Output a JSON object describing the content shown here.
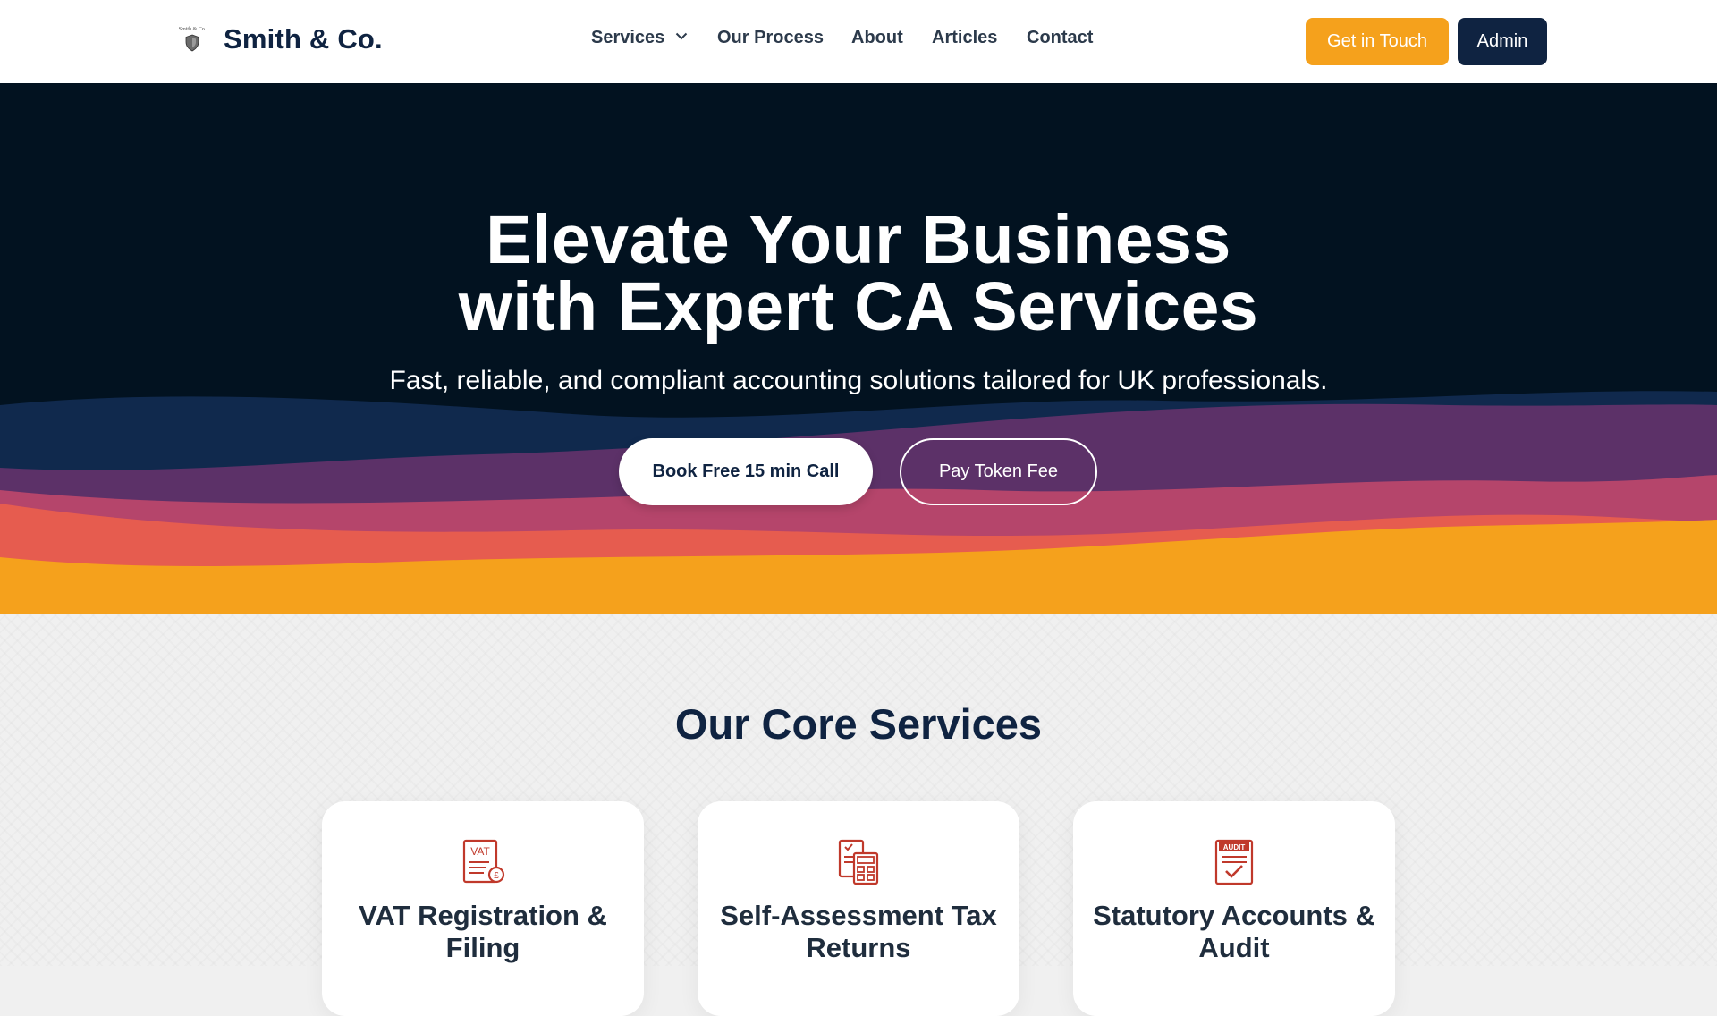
{
  "header": {
    "logo_caption": "Smith & Co.",
    "brand": "Smith & Co.",
    "nav": [
      {
        "label": "Services",
        "has_dropdown": true
      },
      {
        "label": "Our Process"
      },
      {
        "label": "About"
      },
      {
        "label": "Articles"
      },
      {
        "label": "Contact"
      }
    ],
    "get_in_touch": "Get in Touch",
    "admin": "Admin"
  },
  "hero": {
    "title_line1": "Elevate Your Business",
    "title_line2": "with Expert CA Services",
    "subtitle": "Fast, reliable, and compliant accounting solutions tailored for UK professionals.",
    "primary_button": "Book Free 15 min Call",
    "secondary_button": "Pay Token Fee"
  },
  "services": {
    "title": "Our Core Services",
    "cards": [
      {
        "title": "VAT Registration & Filing",
        "icon": "vat-document-icon",
        "icon_label": "VAT"
      },
      {
        "title": "Self-Assessment Tax Returns",
        "icon": "tax-calculator-icon"
      },
      {
        "title": "Statutory Accounts & Audit",
        "icon": "audit-checklist-icon",
        "icon_label": "AUDIT"
      }
    ]
  },
  "colors": {
    "navy": "#0f2341",
    "orange": "#f5a11c",
    "hero_bg": "#021220",
    "wave_purple": "#5c3168",
    "wave_pink": "#b5456b",
    "wave_coral": "#e65c4f",
    "icon_red": "#c0392b"
  }
}
